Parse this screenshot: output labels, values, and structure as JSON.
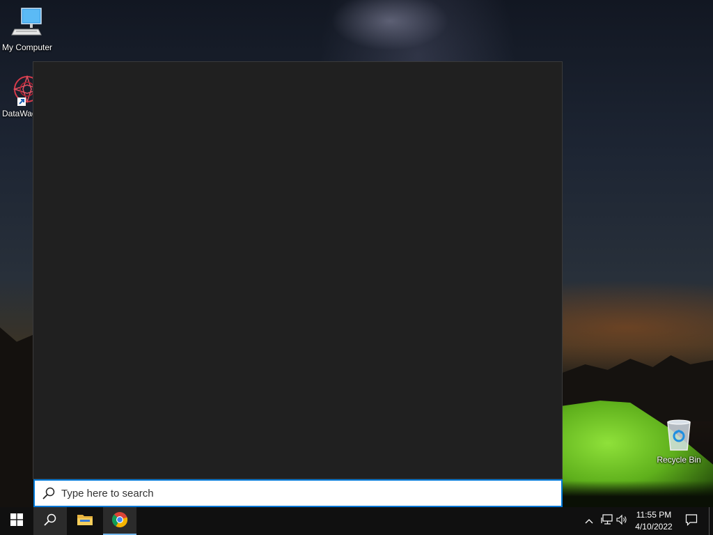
{
  "desktop": {
    "icons": [
      {
        "label": "My Computer",
        "icon": "computer-icon"
      },
      {
        "label": "DataWag",
        "icon": "datawag-shortcut-icon"
      },
      {
        "label": "Recycle Bin",
        "icon": "recycle-bin-icon"
      }
    ]
  },
  "search": {
    "placeholder": "Type here to search",
    "value": "",
    "icon": "search-icon",
    "accent_color": "#0078d7"
  },
  "taskbar": {
    "buttons": [
      {
        "name": "start",
        "icon": "windows-logo-icon"
      },
      {
        "name": "search",
        "icon": "search-icon"
      },
      {
        "name": "file-explorer",
        "icon": "folder-icon"
      },
      {
        "name": "chrome",
        "icon": "chrome-icon"
      }
    ],
    "tray": {
      "icons": [
        "chevron-up-icon",
        "network-icon",
        "volume-icon"
      ],
      "time": "11:55 PM",
      "date": "4/10/2022",
      "notification_icon": "notification-icon"
    }
  }
}
